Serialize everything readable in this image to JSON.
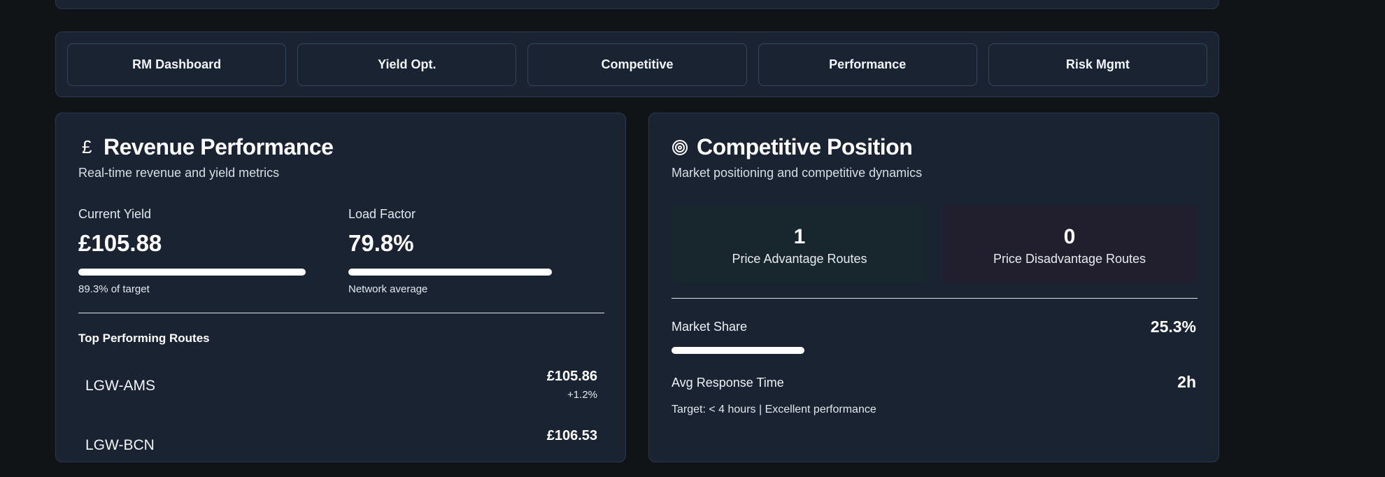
{
  "nav": {
    "tabs": [
      {
        "label": "RM Dashboard"
      },
      {
        "label": "Yield Opt."
      },
      {
        "label": "Competitive"
      },
      {
        "label": "Performance"
      },
      {
        "label": "Risk Mgmt"
      }
    ]
  },
  "revenue": {
    "icon": "pound-icon",
    "icon_glyph": "£",
    "title": "Revenue Performance",
    "subtitle": "Real-time revenue and yield metrics",
    "current_yield": {
      "label": "Current Yield",
      "value": "£105.88",
      "progress": 0.893,
      "note": "89.3% of target"
    },
    "load_factor": {
      "label": "Load Factor",
      "value": "79.8%",
      "progress": 0.798,
      "note": "Network average"
    },
    "top_routes_title": "Top Performing Routes",
    "routes": [
      {
        "name": "LGW-AMS",
        "value": "£105.86",
        "change": "+1.2%"
      },
      {
        "name": "LGW-BCN",
        "value": "£106.53",
        "change": ""
      }
    ]
  },
  "competitive": {
    "icon": "target-icon",
    "title": "Competitive Position",
    "subtitle": "Market positioning and competitive dynamics",
    "advantage": {
      "value": "1",
      "label": "Price Advantage Routes"
    },
    "disadvantage": {
      "value": "0",
      "label": "Price Disadvantage Routes"
    },
    "market_share": {
      "label": "Market Share",
      "value": "25.3%",
      "progress": 0.253
    },
    "response_time": {
      "label": "Avg Response Time",
      "value": "2h"
    },
    "target_note": "Target: < 4 hours | Excellent performance"
  },
  "colors": {
    "background": "#111417",
    "card": "#1a2332",
    "border": "#2c3a4d",
    "advantage_bg": "#18262e",
    "disadvantage_bg": "#211f2e",
    "bar": "#ffffff"
  }
}
